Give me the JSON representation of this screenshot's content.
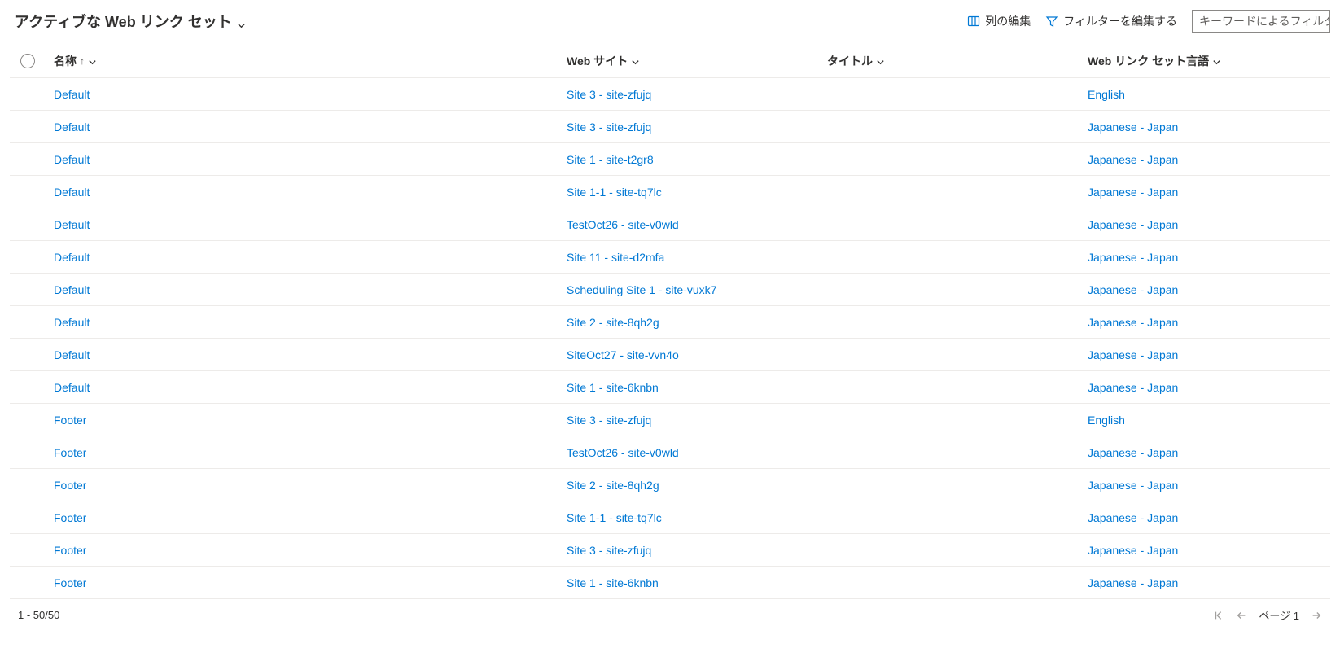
{
  "header": {
    "view_title": "アクティブな Web リンク セット",
    "edit_columns": "列の編集",
    "edit_filters": "フィルターを編集する",
    "search_placeholder": "キーワードによるフィルタ"
  },
  "columns": {
    "name": "名称",
    "website": "Web サイト",
    "title": "タイトル",
    "language": "Web リンク セット言語"
  },
  "rows": [
    {
      "name": "Default",
      "website": "Site 3 - site-zfujq",
      "title": "",
      "language": "English"
    },
    {
      "name": "Default",
      "website": "Site 3 - site-zfujq",
      "title": "",
      "language": "Japanese - Japan"
    },
    {
      "name": "Default",
      "website": "Site 1 - site-t2gr8",
      "title": "",
      "language": "Japanese - Japan"
    },
    {
      "name": "Default",
      "website": "Site 1-1 - site-tq7lc",
      "title": "",
      "language": "Japanese - Japan"
    },
    {
      "name": "Default",
      "website": "TestOct26 - site-v0wld",
      "title": "",
      "language": "Japanese - Japan"
    },
    {
      "name": "Default",
      "website": "Site 11 - site-d2mfa",
      "title": "",
      "language": "Japanese - Japan"
    },
    {
      "name": "Default",
      "website": "Scheduling Site 1 - site-vuxk7",
      "title": "",
      "language": "Japanese - Japan"
    },
    {
      "name": "Default",
      "website": "Site 2 - site-8qh2g",
      "title": "",
      "language": "Japanese - Japan"
    },
    {
      "name": "Default",
      "website": "SiteOct27 - site-vvn4o",
      "title": "",
      "language": "Japanese - Japan"
    },
    {
      "name": "Default",
      "website": "Site 1 - site-6knbn",
      "title": "",
      "language": "Japanese - Japan"
    },
    {
      "name": "Footer",
      "website": "Site 3 - site-zfujq",
      "title": "",
      "language": "English"
    },
    {
      "name": "Footer",
      "website": "TestOct26 - site-v0wld",
      "title": "",
      "language": "Japanese - Japan"
    },
    {
      "name": "Footer",
      "website": "Site 2 - site-8qh2g",
      "title": "",
      "language": "Japanese - Japan"
    },
    {
      "name": "Footer",
      "website": "Site 1-1 - site-tq7lc",
      "title": "",
      "language": "Japanese - Japan"
    },
    {
      "name": "Footer",
      "website": "Site 3 - site-zfujq",
      "title": "",
      "language": "Japanese - Japan"
    },
    {
      "name": "Footer",
      "website": "Site 1 - site-6knbn",
      "title": "",
      "language": "Japanese - Japan"
    }
  ],
  "footer": {
    "range": "1 - 50/50",
    "page_label": "ページ 1"
  }
}
